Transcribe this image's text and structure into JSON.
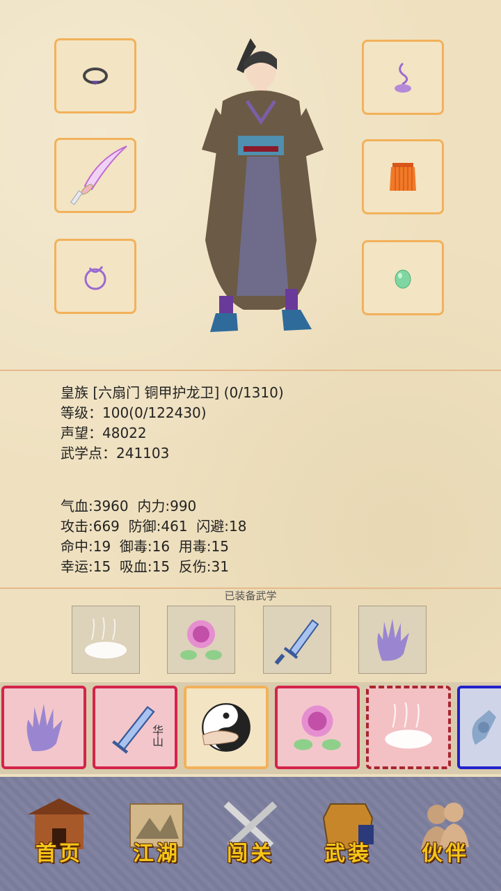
{
  "character": {
    "rank_line": "皇族 [六扇门 铜甲护龙卫] (0/1310)",
    "level_line": "等级：100(0/122430)",
    "prestige_line": "声望：48022",
    "martial_points_line": "武学点：241103"
  },
  "stats": {
    "line1": "气血:3960  内力:990",
    "line2": "攻击:669  防御:461  闪避:18",
    "line3": "命中:19  御毒:16  用毒:15",
    "line4": "幸运:15  吸血:15  反伤:31"
  },
  "equipment_slots": {
    "left": [
      "ring-icon",
      "sword-icon",
      "bracelet-icon"
    ],
    "right": [
      "incense-icon",
      "armor-skirt-icon",
      "jade-egg-icon"
    ]
  },
  "equipped_martial_arts": {
    "title": "已装备武学",
    "items": [
      "mist-skill-icon",
      "rose-skill-icon",
      "huashan-sword-skill-icon",
      "palm-skill-icon"
    ]
  },
  "skill_bar": {
    "huashan_label": "华山",
    "items": [
      "palm-skill-icon",
      "huashan-sword-skill-icon",
      "taiji-skill-icon",
      "rose-skill-icon",
      "mist-skill-icon",
      "hand-skill-icon"
    ]
  },
  "nav": {
    "home": "首页",
    "jianghu": "江湖",
    "stages": "闯关",
    "equipment": "武装",
    "partners": "伙伴"
  },
  "colors": {
    "slot_border": "#f2b15a",
    "card_red": "#d4244a",
    "card_blue": "#2222cc",
    "nav_bg": "#7a7c9c",
    "nav_text": "#f5c518"
  }
}
